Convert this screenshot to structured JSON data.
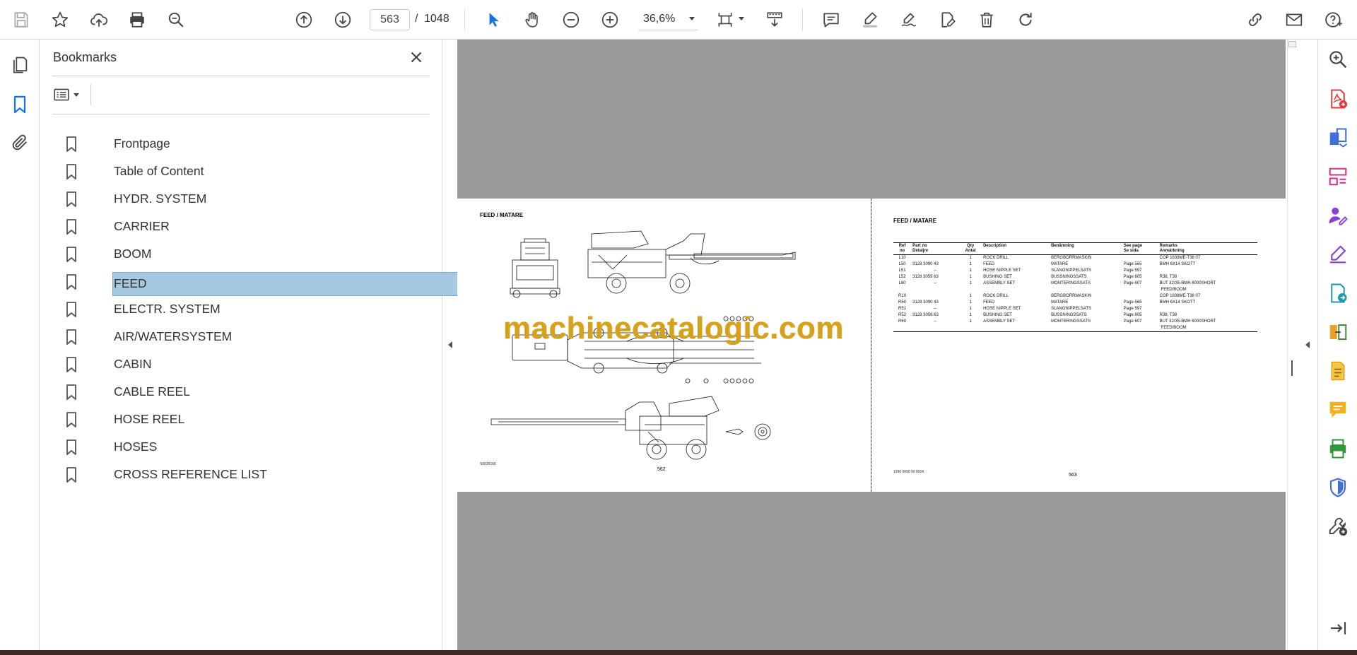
{
  "toolbar": {
    "page_current": "563",
    "page_separator": "/",
    "page_total": "1048",
    "zoom": "36,6%",
    "icons": [
      "save-icon",
      "star-icon",
      "upload-icon",
      "print-icon",
      "find-icon",
      "prev-page-icon",
      "next-page-icon",
      "select-cursor-icon",
      "hand-tool-icon",
      "zoom-out-icon",
      "zoom-in-icon",
      "page-fit-icon",
      "scroll-mode-icon",
      "comment-icon",
      "highlight-icon",
      "sign-icon",
      "edit-text-icon",
      "delete-icon",
      "rotate-icon",
      "share-link-icon",
      "email-icon",
      "help-icon"
    ]
  },
  "left_rail": {
    "icons": [
      "pages-thumbnails-icon",
      "bookmarks-icon",
      "attachments-icon"
    ]
  },
  "bookmarks_panel": {
    "title": "Bookmarks",
    "items": [
      {
        "label": "Frontpage"
      },
      {
        "label": "Table of Content"
      },
      {
        "label": "HYDR. SYSTEM"
      },
      {
        "label": "CARRIER"
      },
      {
        "label": "BOOM"
      },
      {
        "label": "FEED"
      },
      {
        "label": "ELECTR. SYSTEM"
      },
      {
        "label": "AIR/WATERSYSTEM"
      },
      {
        "label": "CABIN"
      },
      {
        "label": "CABLE REEL"
      },
      {
        "label": "HOSE REEL"
      },
      {
        "label": "HOSES"
      },
      {
        "label": "CROSS REFERENCE LIST"
      }
    ],
    "selected_index": 5
  },
  "document": {
    "watermark": "machinecatalogic.com",
    "left_page": {
      "heading": "FEED / MATARE",
      "drawing_number": "S0026160",
      "page_number": "562"
    },
    "right_page": {
      "heading": "FEED / MATARE",
      "doc_code": "1296 5000 50  001K",
      "page_number": "563",
      "table": {
        "headers": [
          [
            "Ref",
            "no"
          ],
          [
            "Part no",
            "Detaljnr"
          ],
          [
            "Qty",
            "Antal"
          ],
          [
            "Description",
            ""
          ],
          [
            "Benämning",
            ""
          ],
          [
            "See page",
            "Se sida"
          ],
          [
            "Remarks",
            "Anmärkning"
          ]
        ],
        "rows": [
          [
            "L10",
            "",
            "1",
            "ROCK DRILL",
            "BERGBORRMASKIN",
            "",
            "COP 1838ME-T38 07"
          ],
          [
            "L50",
            "3128 3090 43",
            "1",
            "FEED",
            "MATARE",
            "Page 565",
            "BMH 6X14 SKOTT"
          ],
          [
            "L51",
            "--",
            "1",
            "HOSE NIPPLE SET",
            "SLANGNIPPELSATS",
            "Page 597",
            ""
          ],
          [
            "L52",
            "3128 3059 63",
            "1",
            "BUSHING SET",
            "BUSSNINGSSATS",
            "Page 605",
            "R38, T38"
          ],
          [
            "L60",
            "--",
            "1",
            "ASSEMBLY SET",
            "MONTERINGSSATS",
            "Page 607",
            "BUT 32/35-BMH 6000SHORT"
          ],
          [
            "",
            "",
            "",
            "",
            "",
            "",
            "FEED/BOOM"
          ],
          [
            "R10",
            "",
            "1",
            "ROCK DRILL",
            "BERGBORRMASKIN",
            "",
            "COP 1838ME-T38 07"
          ],
          [
            "R50",
            "3128 3090 43",
            "1",
            "FEED",
            "MATARE",
            "Page 565",
            "BMH 6X14 SKOTT"
          ],
          [
            "R51",
            "--",
            "1",
            "HOSE NIPPLE SET",
            "SLANGNIPPELSATS",
            "Page 597",
            ""
          ],
          [
            "R52",
            "3128 3059 63",
            "1",
            "BUSHING SET",
            "BUSSNINGSSATS",
            "Page 605",
            "R38, T38"
          ],
          [
            "R60",
            "--",
            "1",
            "ASSEMBLY SET",
            "MONTERINGSSATS",
            "Page 607",
            "BUT 32/35-BMH 6000SHORT"
          ],
          [
            "",
            "",
            "",
            "",
            "",
            "",
            "FEED/BOOM"
          ]
        ]
      }
    }
  },
  "right_rail": {
    "icons": [
      "search-zoom-icon",
      "create-pdf-icon",
      "export-pdf-icon",
      "organize-pages-icon",
      "request-signature-icon",
      "fill-sign-icon",
      "send-for-review-icon",
      "compare-files-icon",
      "edit-pdf-icon",
      "comment-tool-icon",
      "print-production-icon",
      "protect-icon",
      "more-tools-icon",
      "collapse-pane-icon"
    ]
  },
  "colors": {
    "accent": "#1473e6",
    "selection": "#a6c9e2",
    "doc_background": "#9b9b9b",
    "watermark": "#d6a21b"
  }
}
